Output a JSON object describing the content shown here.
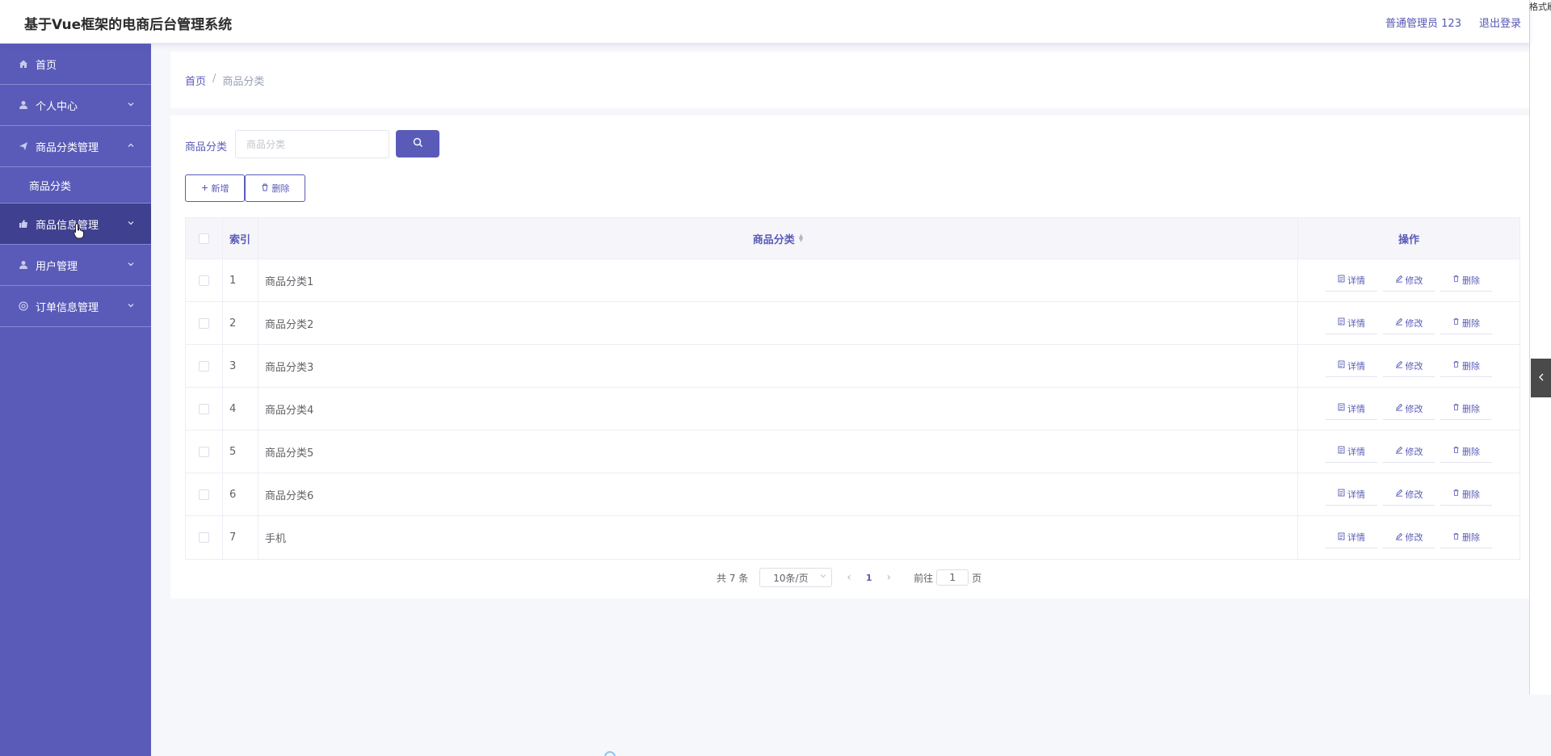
{
  "header": {
    "title": "基于Vue框架的电商后台管理系统",
    "user_label": "普通管理员 123",
    "logout": "退出登录"
  },
  "sidebar": {
    "items": [
      {
        "label": "首页",
        "icon": "home-icon"
      },
      {
        "label": "个人中心",
        "icon": "user-icon"
      },
      {
        "label": "商品分类管理",
        "icon": "send-icon"
      },
      {
        "label": "商品信息管理",
        "icon": "thumb-icon"
      },
      {
        "label": "用户管理",
        "icon": "user-icon"
      },
      {
        "label": "订单信息管理",
        "icon": "help-icon"
      }
    ],
    "submenu": {
      "label": "商品分类"
    }
  },
  "breadcrumb": {
    "home": "首页",
    "separator": "/",
    "current": "商品分类"
  },
  "search": {
    "label": "商品分类",
    "placeholder": "商品分类"
  },
  "actions": {
    "add": "新增",
    "delete": "删除"
  },
  "table": {
    "headers": {
      "index": "索引",
      "name": "商品分类",
      "ops": "操作"
    },
    "op_labels": {
      "detail": "详情",
      "edit": "修改",
      "delete": "删除"
    },
    "rows": [
      {
        "index": "1",
        "name": "商品分类1"
      },
      {
        "index": "2",
        "name": "商品分类2"
      },
      {
        "index": "3",
        "name": "商品分类3"
      },
      {
        "index": "4",
        "name": "商品分类4"
      },
      {
        "index": "5",
        "name": "商品分类5"
      },
      {
        "index": "6",
        "name": "商品分类6"
      },
      {
        "index": "7",
        "name": "手机"
      }
    ]
  },
  "pagination": {
    "total": "共 7 条",
    "page_size": "10条/页",
    "current_page": "1",
    "goto_label": "前往",
    "goto_value": "1",
    "page_suffix": "页"
  },
  "edge": {
    "text": "格式刷"
  },
  "colors": {
    "primary": "#5a5bb8",
    "sidebar_active": "#3f408f",
    "background": "#f6f7fb"
  }
}
